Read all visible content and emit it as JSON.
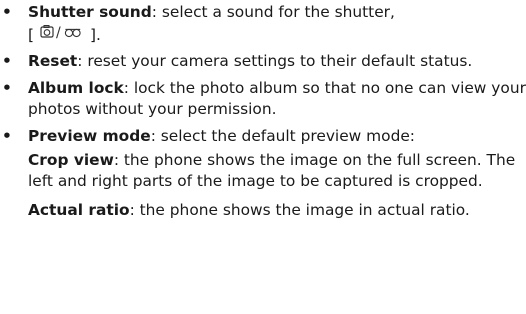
{
  "items": [
    {
      "term": "Shutter sound",
      "text": ": select a sound for the shutter, ",
      "bracket_open": "[",
      "icon_name": "camera-sound-icon",
      "slash": "/",
      "icon2_name": "camcorder-sound-icon",
      "bracket_close": "]",
      "end": "."
    },
    {
      "term": "Reset",
      "text": ": reset your camera settings to their default status."
    },
    {
      "term": "Album lock",
      "text": ": lock the photo album so that no one can view your photos without your permission."
    },
    {
      "term": "Preview mode",
      "text": ": select the default preview mode:",
      "sub": [
        {
          "term": "Crop view",
          "text": ": the phone shows the image on the full screen. The left and right parts of the image to be captured is cropped."
        },
        {
          "term": "Actual ratio",
          "text": ": the phone shows the image in actual ratio."
        }
      ]
    }
  ],
  "bullet_glyph": "•"
}
